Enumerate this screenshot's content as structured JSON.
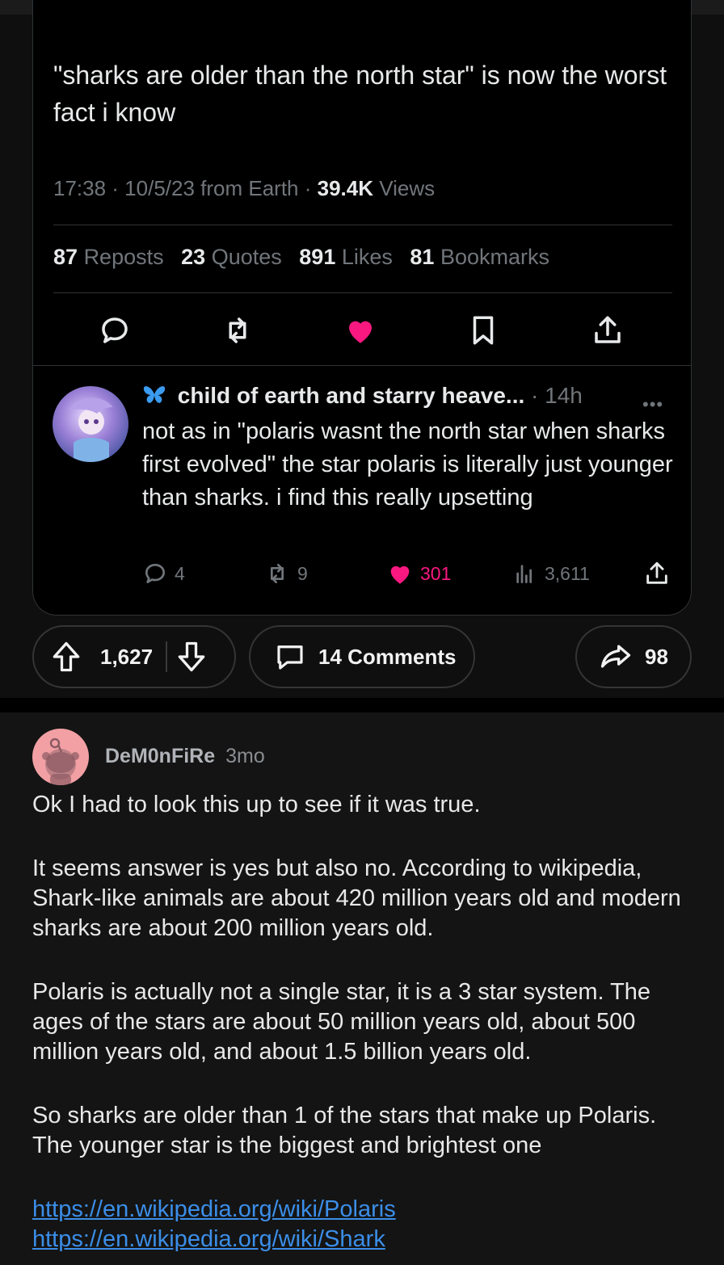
{
  "tweet": {
    "text": "\"sharks are older than the north star\" is now the worst fact i know",
    "time_date_source": "17:38 · 10/5/23 from Earth · ",
    "views_count": "39.4K",
    "views_label": " Views",
    "stats": [
      {
        "count": "87",
        "label": "Reposts"
      },
      {
        "count": "23",
        "label": "Quotes"
      },
      {
        "count": "891",
        "label": "Likes"
      },
      {
        "count": "81",
        "label": "Bookmarks"
      }
    ],
    "accent_like_color": "#f91880"
  },
  "reply": {
    "display_name": "child of earth and starry heave...",
    "time": " · 14h",
    "more": "•••",
    "body": "not as in \"polaris wasnt the north star when sharks first evolved\" the star polaris is literally just younger than sharks. i find this really upsetting",
    "replies": "4",
    "reposts": "9",
    "likes": "301",
    "views": "3,611"
  },
  "post_actions": {
    "score": "1,627",
    "comments": "14 Comments",
    "shares": "98"
  },
  "comment": {
    "username": "DeM0nFiRe",
    "age": "3mo",
    "paragraphs": [
      "Ok I had to look this up to see if it was true.",
      "It seems answer is yes but also no. According to wikipedia, Shark-like animals are about 420 million years old and modern sharks are about 200 million years old.",
      "Polaris is actually not a single star, it is a 3 star system. The ages of the stars are about 50 million years old, about 500 million years old, and about 1.5 billion years old.",
      "So sharks are older than 1 of the stars that make up Polaris. The younger star is the biggest and brightest one"
    ],
    "link1": "https://en.wikipedia.org/wiki/Polaris",
    "link2": "https://en.wikipedia.org/wiki/Shark"
  }
}
